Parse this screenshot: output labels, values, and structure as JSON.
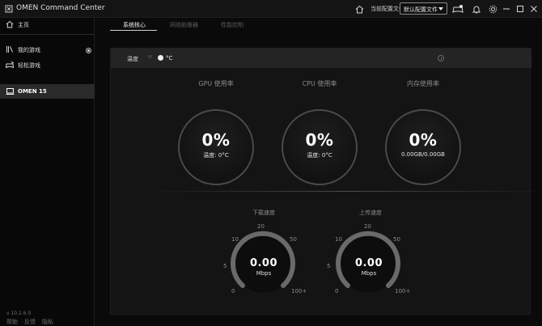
{
  "app": {
    "title": "OMEN Command Center"
  },
  "header": {
    "profile_label": "当前配置文件",
    "profile_value": "默认配置文件"
  },
  "sidebar": {
    "items": [
      {
        "label": "主页"
      },
      {
        "label": "我的游戏"
      },
      {
        "label": "轻松游戏"
      }
    ],
    "device": "OMEN 15",
    "version": "v 10.2.6.0",
    "footer": [
      "帮助",
      "反馈",
      "隐私"
    ]
  },
  "tabs": [
    "系统核心",
    "网络助推器",
    "性能控制"
  ],
  "panel": {
    "temp_label": "温度",
    "unit_f": "°F",
    "unit_c": "°C"
  },
  "metrics": [
    {
      "title": "GPU 使用率",
      "value": "0%",
      "sub": "温度: 0°C"
    },
    {
      "title": "CPU 使用率",
      "value": "0%",
      "sub": "温度: 0°C"
    },
    {
      "title": "内存使用率",
      "value": "0%",
      "sub": "0.00GB/0.00GB"
    }
  ],
  "speeds": [
    {
      "title": "下载速度",
      "value": "0.00",
      "unit": "Mbps"
    },
    {
      "title": "上传速度",
      "value": "0.00",
      "unit": "Mbps"
    }
  ],
  "gauge_ticks": [
    "0",
    "5",
    "10",
    "20",
    "50",
    "100+"
  ],
  "colors": {
    "background": "#0a0a0a",
    "panel": "#141414",
    "active_row": "#2a2a2a"
  }
}
